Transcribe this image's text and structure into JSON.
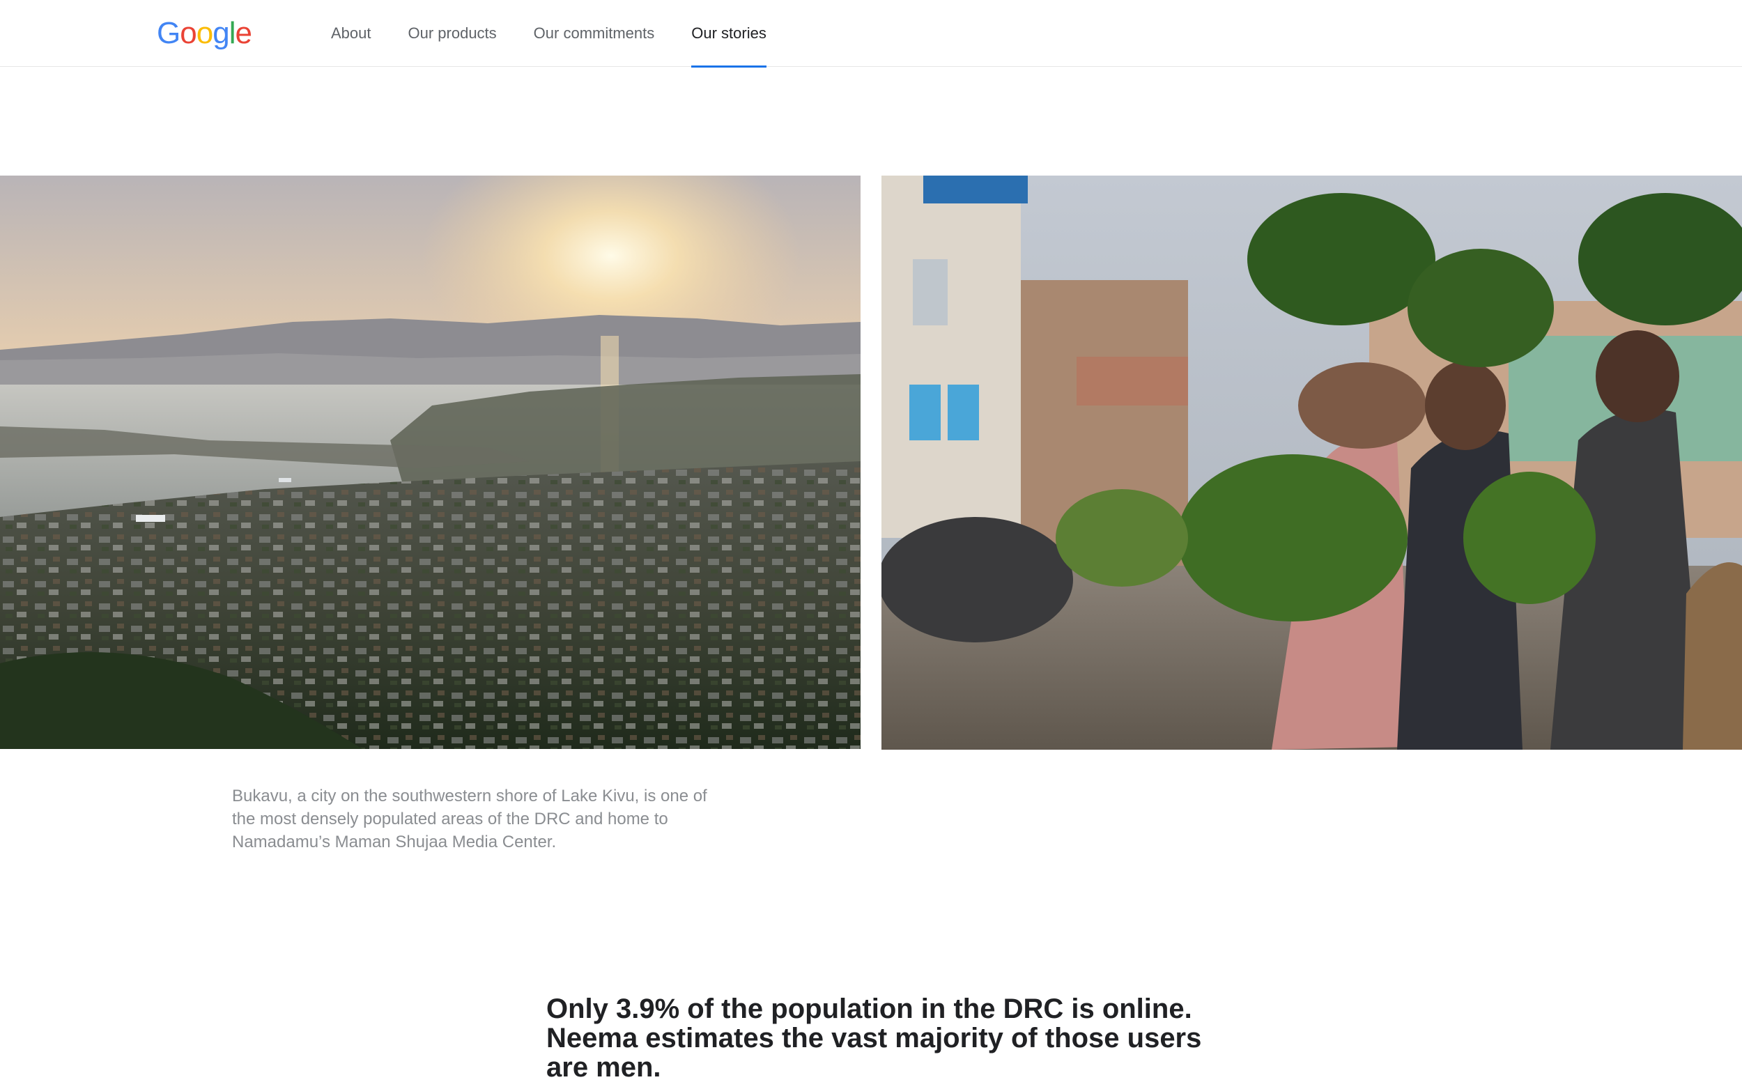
{
  "nav": {
    "logo_letters": [
      {
        "char": "G",
        "color": "#4285F4"
      },
      {
        "char": "o",
        "color": "#EA4335"
      },
      {
        "char": "o",
        "color": "#FBBC05"
      },
      {
        "char": "g",
        "color": "#4285F4"
      },
      {
        "char": "l",
        "color": "#34A853"
      },
      {
        "char": "e",
        "color": "#EA4335"
      }
    ],
    "links": [
      {
        "label": "About",
        "active": false
      },
      {
        "label": "Our products",
        "active": false
      },
      {
        "label": "Our commitments",
        "active": false
      },
      {
        "label": "Our stories",
        "active": true
      }
    ],
    "active_underline_color": "#1a73e8"
  },
  "story": {
    "photo_left": "aerial-city-lake-sunset",
    "photo_right": "women-carrying-greens-street",
    "caption": "Bukavu, a city on the southwestern shore of Lake Kivu, is one of the most densely populated areas of the DRC and home to Namadamu’s Maman Shujaa Media Center.",
    "pullquote": "Only 3.9% of the population in the DRC is online. Neema estimates the vast majority of those users are men."
  }
}
